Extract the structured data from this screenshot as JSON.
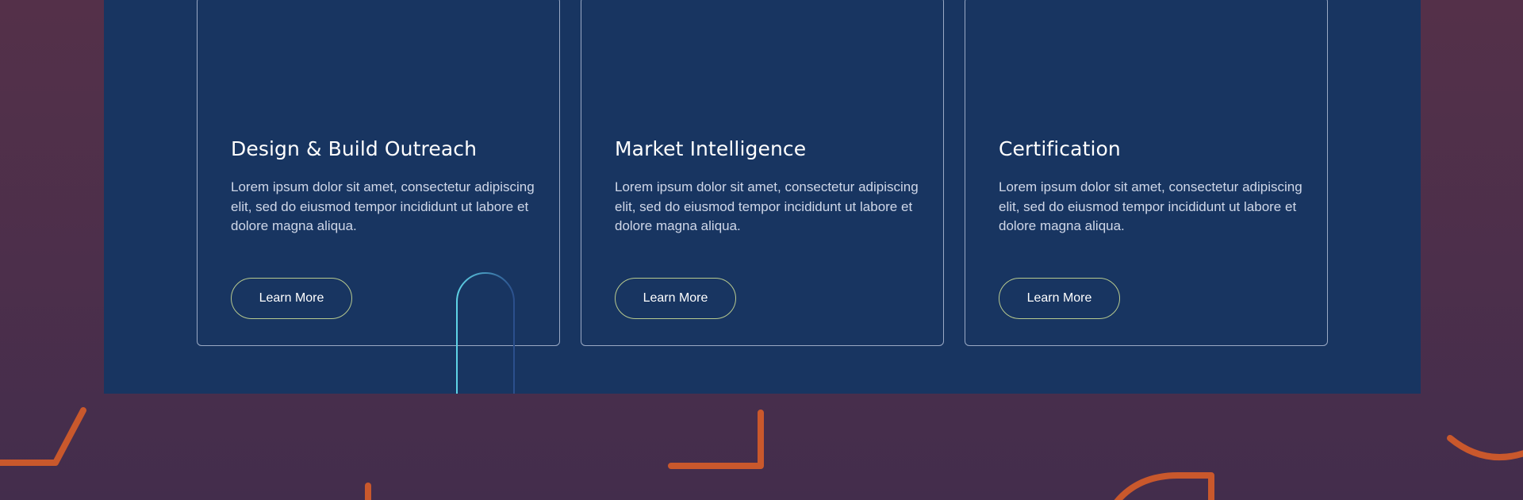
{
  "cards": [
    {
      "title": "Design & Build Outreach",
      "description": "Lorem ipsum dolor sit amet, consectetur adipiscing elit, sed do eiusmod tempor incididunt ut labore et dolore magna aliqua.",
      "button_label": "Learn More"
    },
    {
      "title": "Market Intelligence",
      "description": "Lorem ipsum dolor sit amet, consectetur adipiscing elit, sed do eiusmod tempor incididunt ut labore et dolore magna aliqua.",
      "button_label": "Learn More"
    },
    {
      "title": "Certification",
      "description": "Lorem ipsum dolor sit amet, consectetur adipiscing elit, sed do eiusmod tempor incididunt ut labore et dolore magna aliqua.",
      "button_label": "Learn More"
    }
  ],
  "colors": {
    "background": "#4c2f4b",
    "panel": "#183561",
    "card_border": "#9aa9c4",
    "button_border": "#b7c98f",
    "accent_orange": "#c9582c",
    "accent_cyan": "#4fc3d8"
  }
}
